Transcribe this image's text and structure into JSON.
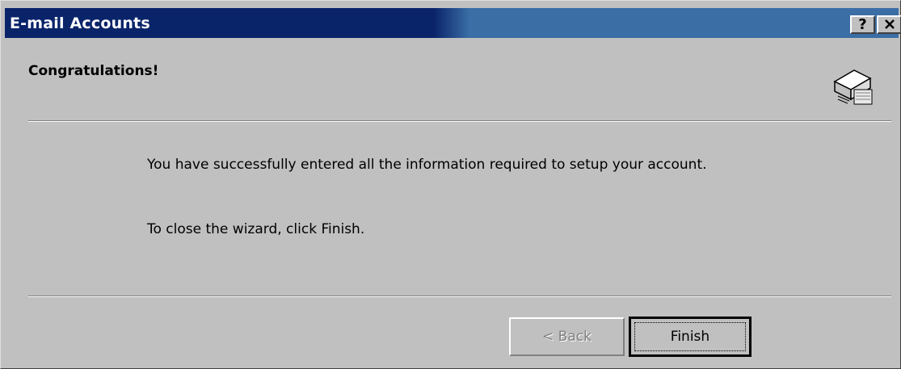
{
  "window": {
    "title": "E-mail Accounts",
    "help_button": "?",
    "close_button": "✕"
  },
  "wizard": {
    "heading": "Congratulations!",
    "icon": "email-wizard-icon",
    "message_1": "You have successfully entered all the information required to setup your account.",
    "message_2": "To close the wizard, click Finish."
  },
  "buttons": {
    "back_label": "< Back",
    "back_enabled": false,
    "finish_label": "Finish"
  },
  "colors": {
    "titlebar_start": "#0a246a",
    "titlebar_end": "#3a6ea5",
    "dialog_face": "#c0c0c0"
  }
}
